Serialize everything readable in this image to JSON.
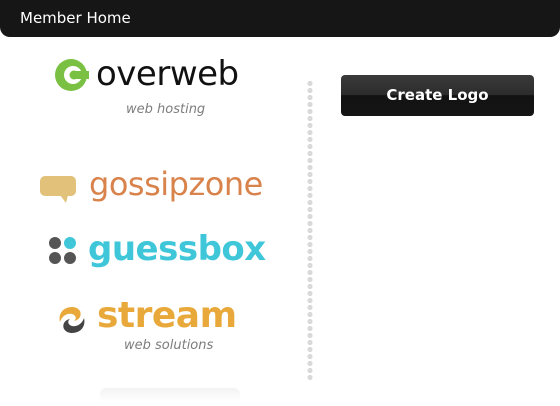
{
  "header": {
    "title": "Member Home"
  },
  "actions": {
    "create_logo_label": "Create Logo"
  },
  "logos": [
    {
      "name": "overweb",
      "tagline": "web hosting",
      "icon": "overweb-c-icon",
      "color": "#111111",
      "accent": "#7ac143"
    },
    {
      "name": "gossipzone",
      "tagline": "",
      "icon": "speech-bubble-icon",
      "color": "#d9834c",
      "accent": "#e2c27a"
    },
    {
      "name": "guessbox",
      "tagline": "",
      "icon": "four-dots-icon",
      "color": "#3fc7d9",
      "accent": "#555555"
    },
    {
      "name": "stream",
      "tagline": "web solutions",
      "icon": "stream-swirl-icon",
      "color": "#e8a93a",
      "accent": "#444444"
    }
  ],
  "colors": {
    "header_bg": "#161616",
    "button_bg": "#1c1c1c",
    "divider": "#d9d9d9"
  }
}
